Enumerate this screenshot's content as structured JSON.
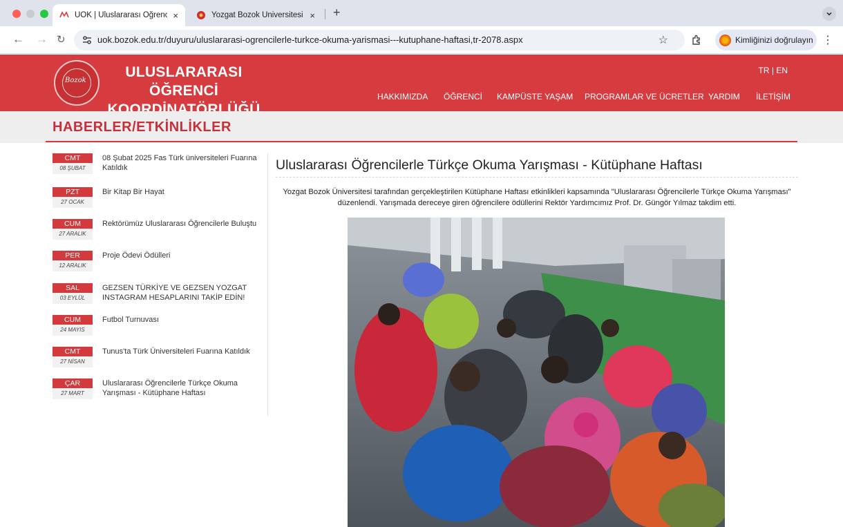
{
  "browser": {
    "tabs": [
      {
        "title": "UOK | Uluslararası Öğrenciler",
        "active": true
      },
      {
        "title": "Yozgat Bozok Üniversitesi",
        "active": false
      }
    ],
    "url": "uok.bozok.edu.tr/duyuru/uluslararasi-ogrencilerle-turkce-okuma-yarismasi---kutuphane-haftasi,tr-2078.aspx",
    "profile_label": "Kimliğinizi doğrulayın",
    "close_glyph": "×",
    "newtab_glyph": "+"
  },
  "site": {
    "title_line1": "ULUSLARARASI ÖĞRENCİ",
    "title_line2": "KOORDİNATÖRLÜĞÜ",
    "logo_text": "Bozok",
    "lang": "TR | EN",
    "nav": [
      "HAKKIMIZDA",
      "ÖĞRENCİ",
      "KAMPÜSTE YAŞAM",
      "PROGRAMLAR VE ÜCRETLER",
      "YARDIM",
      "İLETİŞİM"
    ],
    "brand_color": "#d63c3f"
  },
  "page": {
    "section_title": "HABERLER/ETKİNLİKLER"
  },
  "news": [
    {
      "day": "CMT",
      "date": "08 ŞUBAT",
      "title": "08 Şubat 2025 Fas Türk üniversiteleri Fuarına Katıldık"
    },
    {
      "day": "PZT",
      "date": "27 OCAK",
      "title": "Bir Kitap Bir Hayat"
    },
    {
      "day": "CUM",
      "date": "27 ARALIK",
      "title": "Rektörümüz Uluslararası Öğrencilerle Buluştu"
    },
    {
      "day": "PER",
      "date": "12 ARALIK",
      "title": "Proje Ödevi Ödülleri"
    },
    {
      "day": "SAL",
      "date": "03 EYLÜL",
      "title": "GEZSEN TÜRKİYE VE GEZSEN YOZGAT INSTAGRAM HESAPLARINI TAKİP EDİN!"
    },
    {
      "day": "CUM",
      "date": "24 MAYIS",
      "title": "Futbol Turnuvası"
    },
    {
      "day": "CMT",
      "date": "27 NİSAN",
      "title": "Tunus'ta Türk Üniversiteleri Fuarına Katıldık"
    },
    {
      "day": "ÇAR",
      "date": "27 MART",
      "title": "Uluslararası Öğrencilerle Türkçe Okuma Yarışması - Kütüphane Haftası"
    }
  ],
  "article": {
    "title": "Uluslararası Öğrencilerle Türkçe Okuma Yarışması - Kütüphane Haftası",
    "body": "Yozgat Bozok Üniversitesi tarafından gerçekleştirilen Kütüphane Haftası etkinlikleri kapsamında \"Uluslararası Öğrencilerle Türkçe Okuma Yarışması\" düzenlendi. Yarışmada dereceye giren öğrencilere ödüllerini Rektör Yardımcımız Prof. Dr. Güngör Yılmaz takdim etti."
  }
}
